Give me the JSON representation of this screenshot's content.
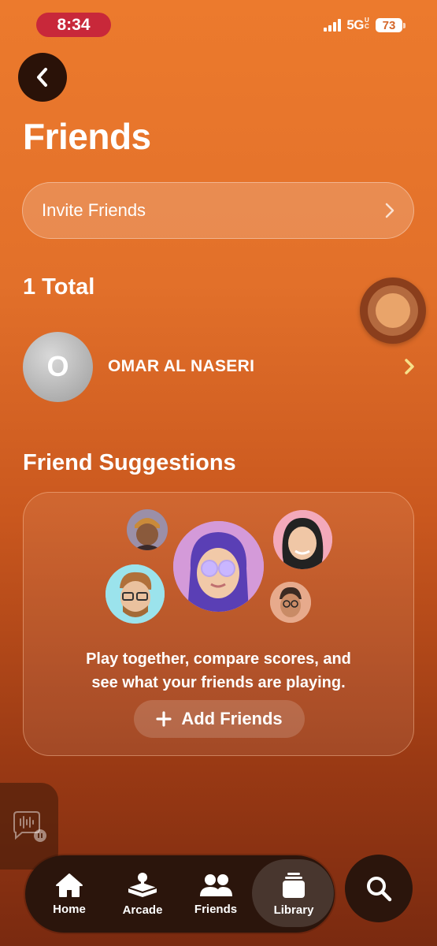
{
  "status": {
    "time": "8:34",
    "network": "5G",
    "network_suffix": "UC",
    "battery": "73"
  },
  "header": {
    "title": "Friends"
  },
  "invite": {
    "label": "Invite Friends"
  },
  "friends": {
    "total_label": "1 Total",
    "items": [
      {
        "initial": "O",
        "name": "OMAR AL NASERI"
      }
    ]
  },
  "suggestions": {
    "title": "Friend Suggestions",
    "description_line1": "Play together, compare scores, and",
    "description_line2": "see what your friends are playing.",
    "add_button": "Add Friends"
  },
  "tabs": [
    {
      "label": "Home",
      "icon": "house-icon"
    },
    {
      "label": "Arcade",
      "icon": "joystick-icon"
    },
    {
      "label": "Friends",
      "icon": "people-icon"
    },
    {
      "label": "Library",
      "icon": "stack-icon",
      "selected": true
    }
  ],
  "colors": {
    "accent": "#e8752b",
    "status_pill": "#c8283a",
    "tabbar": "#2b150c"
  }
}
